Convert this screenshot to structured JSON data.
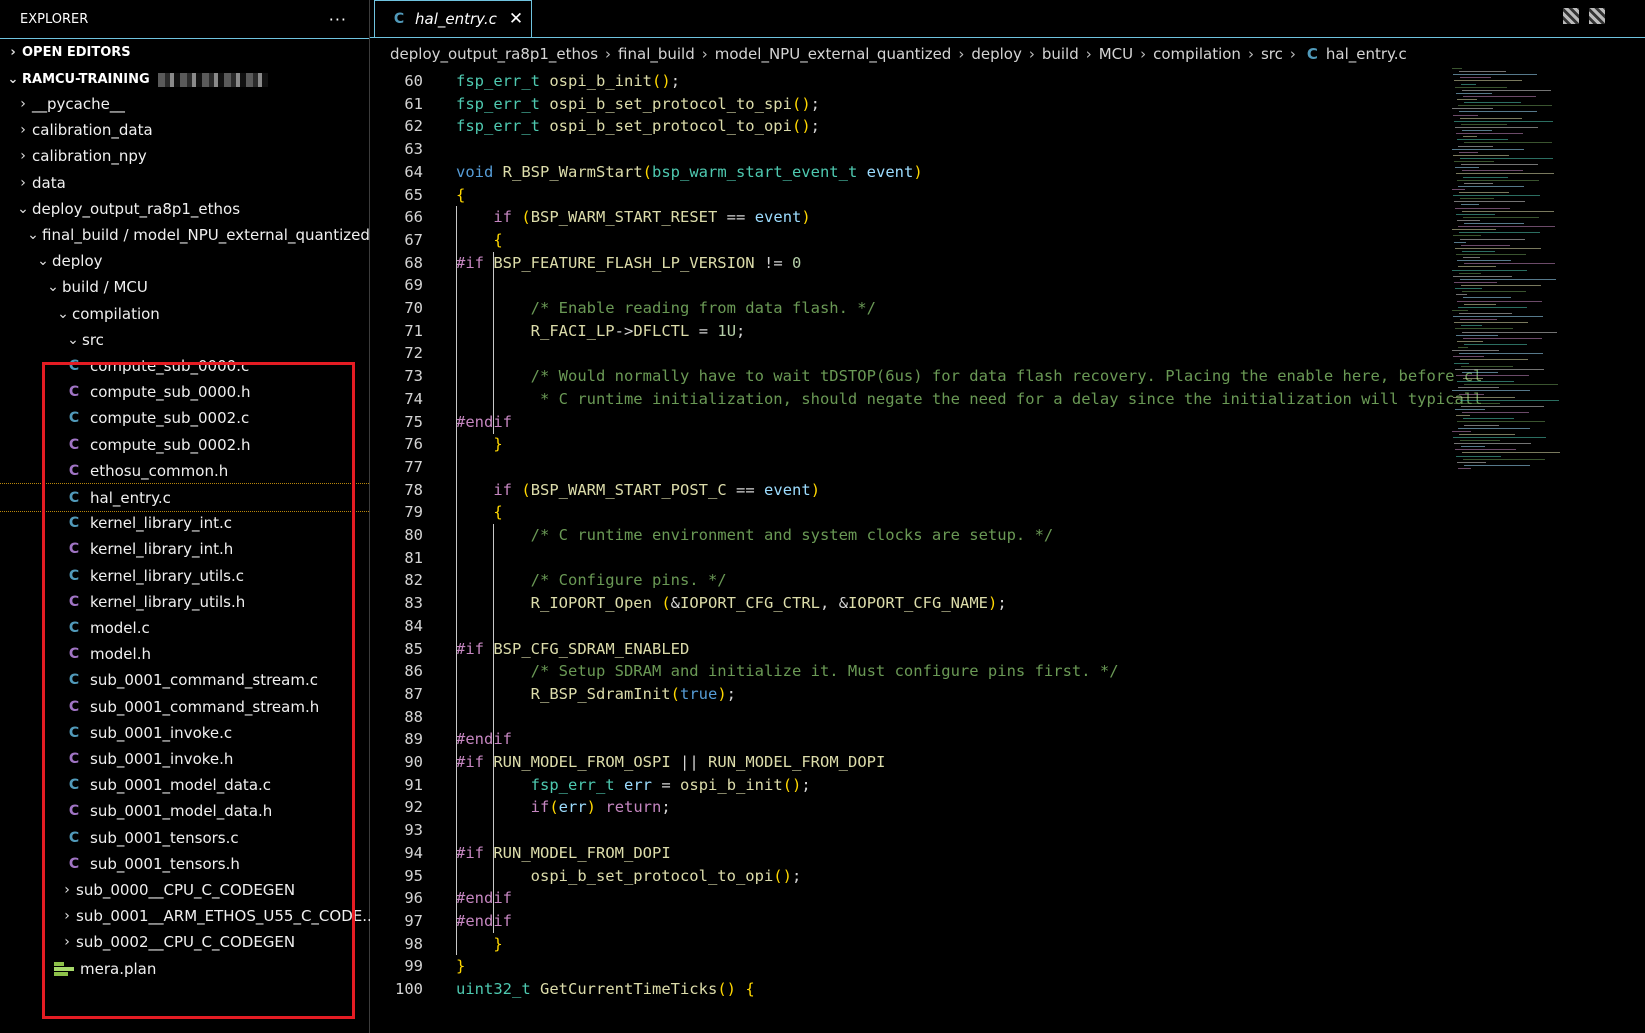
{
  "sidebar": {
    "title": "EXPLORER",
    "more_label": "···",
    "open_editors_label": "OPEN EDITORS",
    "workspace_label": "RAMCU-TRAINING",
    "tree": [
      {
        "label": "__pycache__",
        "kind": "folder",
        "expanded": false
      },
      {
        "label": "calibration_data",
        "kind": "folder",
        "expanded": false
      },
      {
        "label": "calibration_npy",
        "kind": "folder",
        "expanded": false
      },
      {
        "label": "data",
        "kind": "folder",
        "expanded": false
      },
      {
        "label": "deploy_output_ra8p1_ethos",
        "kind": "folder",
        "expanded": true
      },
      {
        "label": "final_build / model_NPU_external_quantized",
        "kind": "folder",
        "expanded": true
      },
      {
        "label": "deploy",
        "kind": "folder",
        "expanded": true
      },
      {
        "label": "build / MCU",
        "kind": "folder",
        "expanded": true
      },
      {
        "label": "compilation",
        "kind": "folder",
        "expanded": true
      },
      {
        "label": "src",
        "kind": "folder",
        "expanded": true
      },
      {
        "label": "compute_sub_0000.c",
        "kind": "c"
      },
      {
        "label": "compute_sub_0000.h",
        "kind": "h"
      },
      {
        "label": "compute_sub_0002.c",
        "kind": "c"
      },
      {
        "label": "compute_sub_0002.h",
        "kind": "h"
      },
      {
        "label": "ethosu_common.h",
        "kind": "h"
      },
      {
        "label": "hal_entry.c",
        "kind": "c",
        "selected": true
      },
      {
        "label": "kernel_library_int.c",
        "kind": "c"
      },
      {
        "label": "kernel_library_int.h",
        "kind": "h"
      },
      {
        "label": "kernel_library_utils.c",
        "kind": "c"
      },
      {
        "label": "kernel_library_utils.h",
        "kind": "h"
      },
      {
        "label": "model.c",
        "kind": "c"
      },
      {
        "label": "model.h",
        "kind": "h"
      },
      {
        "label": "sub_0001_command_stream.c",
        "kind": "c"
      },
      {
        "label": "sub_0001_command_stream.h",
        "kind": "h"
      },
      {
        "label": "sub_0001_invoke.c",
        "kind": "c"
      },
      {
        "label": "sub_0001_invoke.h",
        "kind": "h"
      },
      {
        "label": "sub_0001_model_data.c",
        "kind": "c"
      },
      {
        "label": "sub_0001_model_data.h",
        "kind": "h"
      },
      {
        "label": "sub_0001_tensors.c",
        "kind": "c"
      },
      {
        "label": "sub_0001_tensors.h",
        "kind": "h"
      },
      {
        "label": "sub_0000__CPU_C_CODEGEN",
        "kind": "folder",
        "expanded": false
      },
      {
        "label": "sub_0001__ARM_ETHOS_U55_C_CODE...",
        "kind": "folder",
        "expanded": false
      },
      {
        "label": "sub_0002__CPU_C_CODEGEN",
        "kind": "folder",
        "expanded": false
      },
      {
        "label": "mera.plan",
        "kind": "plan"
      }
    ]
  },
  "editor": {
    "tab_label": "hal_entry.c",
    "tab_icon": "C",
    "close_icon": "✕",
    "breadcrumb": [
      "deploy_output_ra8p1_ethos",
      "final_build",
      "model_NPU_external_quantized",
      "deploy",
      "build",
      "MCU",
      "compilation",
      "src",
      "hal_entry.c"
    ],
    "code_lines": [
      {
        "n": "60",
        "t": "fsp_err_t ospi_b_init();"
      },
      {
        "n": "61",
        "t": "fsp_err_t ospi_b_set_protocol_to_spi();"
      },
      {
        "n": "62",
        "t": "fsp_err_t ospi_b_set_protocol_to_opi();"
      },
      {
        "n": "63",
        "t": ""
      },
      {
        "n": "64",
        "t": "void R_BSP_WarmStart(bsp_warm_start_event_t event)"
      },
      {
        "n": "65",
        "t": "{"
      },
      {
        "n": "66",
        "t": "    if (BSP_WARM_START_RESET == event)"
      },
      {
        "n": "67",
        "t": "    {"
      },
      {
        "n": "68",
        "t": "#if BSP_FEATURE_FLASH_LP_VERSION != 0"
      },
      {
        "n": "69",
        "t": ""
      },
      {
        "n": "70",
        "t": "        /* Enable reading from data flash. */"
      },
      {
        "n": "71",
        "t": "        R_FACI_LP->DFLCTL = 1U;"
      },
      {
        "n": "72",
        "t": ""
      },
      {
        "n": "73",
        "t": "        /* Would normally have to wait tDSTOP(6us) for data flash recovery. Placing the enable here, before cl"
      },
      {
        "n": "74",
        "t": "         * C runtime initialization, should negate the need for a delay since the initialization will typicall"
      },
      {
        "n": "75",
        "t": "#endif"
      },
      {
        "n": "76",
        "t": "    }"
      },
      {
        "n": "77",
        "t": ""
      },
      {
        "n": "78",
        "t": "    if (BSP_WARM_START_POST_C == event)"
      },
      {
        "n": "79",
        "t": "    {"
      },
      {
        "n": "80",
        "t": "        /* C runtime environment and system clocks are setup. */"
      },
      {
        "n": "81",
        "t": ""
      },
      {
        "n": "82",
        "t": "        /* Configure pins. */"
      },
      {
        "n": "83",
        "t": "        R_IOPORT_Open (&IOPORT_CFG_CTRL, &IOPORT_CFG_NAME);"
      },
      {
        "n": "84",
        "t": ""
      },
      {
        "n": "85",
        "t": "#if BSP_CFG_SDRAM_ENABLED"
      },
      {
        "n": "86",
        "t": "        /* Setup SDRAM and initialize it. Must configure pins first. */"
      },
      {
        "n": "87",
        "t": "        R_BSP_SdramInit(true);"
      },
      {
        "n": "88",
        "t": ""
      },
      {
        "n": "89",
        "t": "#endif"
      },
      {
        "n": "90",
        "t": "#if RUN_MODEL_FROM_OSPI || RUN_MODEL_FROM_DOPI"
      },
      {
        "n": "91",
        "t": "        fsp_err_t err = ospi_b_init();"
      },
      {
        "n": "92",
        "t": "        if(err) return;"
      },
      {
        "n": "93",
        "t": ""
      },
      {
        "n": "94",
        "t": "#if RUN_MODEL_FROM_DOPI"
      },
      {
        "n": "95",
        "t": "        ospi_b_set_protocol_to_opi();"
      },
      {
        "n": "96",
        "t": "#endif"
      },
      {
        "n": "97",
        "t": "#endif"
      },
      {
        "n": "98",
        "t": "    }"
      },
      {
        "n": "99",
        "t": "}"
      },
      {
        "n": "100",
        "t": "uint32_t GetCurrentTimeTicks() {"
      }
    ]
  },
  "colors": {
    "background": "#000000",
    "accent_border": "#6fc3df",
    "highlight_box": "#e51c23",
    "keyword": "#569cd6",
    "type": "#4ec9b0",
    "comment": "#6a9955",
    "control": "#c586c0"
  }
}
